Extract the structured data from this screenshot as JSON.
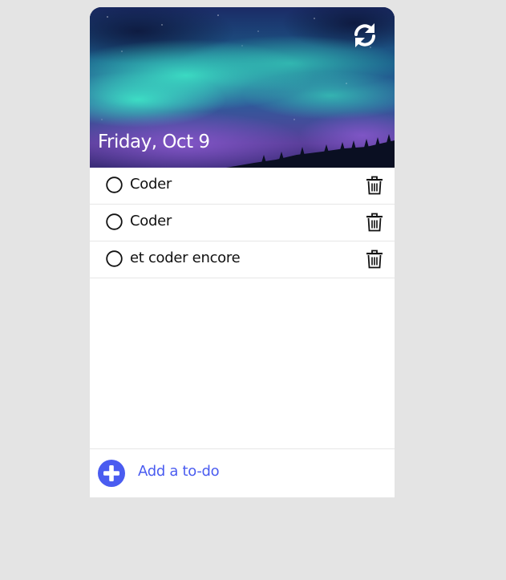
{
  "header": {
    "date": "Friday, Oct 9",
    "refresh_icon": "refresh-icon"
  },
  "todos": [
    {
      "text": "Coder",
      "done": false
    },
    {
      "text": "Coder",
      "done": false
    },
    {
      "text": "et coder encore",
      "done": false
    }
  ],
  "footer": {
    "add_label": "Add a to-do",
    "add_icon": "plus-circle-icon"
  },
  "colors": {
    "accent": "#4a5cf0",
    "background": "#e4e4e4",
    "card": "#ffffff"
  }
}
